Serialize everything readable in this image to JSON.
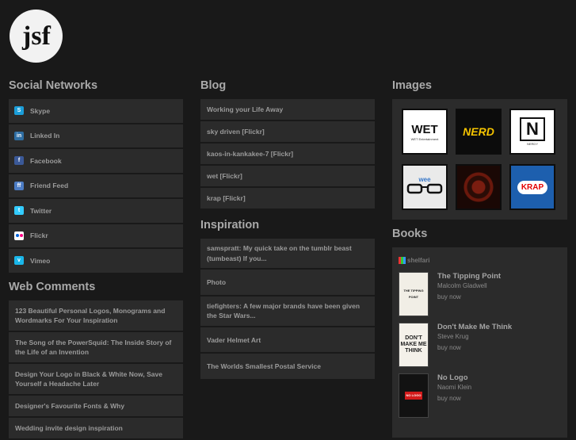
{
  "logo": {
    "text": "jsf"
  },
  "social": {
    "title": "Social Networks",
    "items": [
      {
        "label": "Skype",
        "icon": "skype-icon",
        "color": "#1b9ed9"
      },
      {
        "label": "Linked In",
        "icon": "linkedin-icon",
        "color": "#2f6ea3"
      },
      {
        "label": "Facebook",
        "icon": "facebook-icon",
        "color": "#3b5998"
      },
      {
        "label": "Friend Feed",
        "icon": "friendfeed-icon",
        "color": "#4c7cc4"
      },
      {
        "label": "Twitter",
        "icon": "twitter-icon",
        "color": "#33ccff"
      },
      {
        "label": "Flickr",
        "icon": "flickr-icon",
        "color": "#ffffff"
      },
      {
        "label": "Vimeo",
        "icon": "vimeo-icon",
        "color": "#1ab7ea"
      }
    ]
  },
  "comments": {
    "title": "Web Comments",
    "items": [
      "123 Beautiful Personal Logos, Monograms and Wordmarks For Your Inspiration",
      "The Song of the PowerSquid: The Inside Story of the Life of an Invention",
      "Design Your Logo in Black & White Now, Save Yourself a Headache Later",
      "Designer's Favourite Fonts & Why",
      "Wedding invite design inspiration"
    ]
  },
  "blog": {
    "title": "Blog",
    "items": [
      "Working your Life Away",
      "sky driven [Flickr]",
      "kaos-in-kankakee-7 [Flickr]",
      "wet [Flickr]",
      "krap [Flickr]"
    ]
  },
  "inspiration": {
    "title": "Inspiration",
    "items": [
      "samspratt: My quick take on the tumblr beast (tumbeast) If you...",
      "Photo",
      "tiefighters: A few major brands have been given the Star Wars...",
      "Vader Helmet Art",
      "The Worlds Smallest Postal Service"
    ]
  },
  "images": {
    "title": "Images",
    "thumbs": [
      {
        "name": "wet-thumbnail",
        "text": "WET",
        "sub": "WET Entertainment"
      },
      {
        "name": "nerd-thumbnail",
        "text": "NERD"
      },
      {
        "name": "nerdy-rating-thumbnail",
        "text": "N",
        "sub": "NERDY"
      },
      {
        "name": "glasses-thumbnail",
        "text": "wee"
      },
      {
        "name": "red-pattern-thumbnail",
        "text": ""
      },
      {
        "name": "krap-thumbnail",
        "text": "KRAP"
      }
    ]
  },
  "books": {
    "title": "Books",
    "badge": "shelfari",
    "items": [
      {
        "title": "The Tipping Point",
        "author": "Malcolm Gladwell",
        "buy": "buy now",
        "cover_text": "THE TIPPING POINT",
        "cover_color": "#f1eee6"
      },
      {
        "title": "Don't Make Me Think",
        "author": "Steve Krug",
        "buy": "buy now",
        "cover_text": "DON'T MAKE ME THINK",
        "cover_color": "#f4f1ea"
      },
      {
        "title": "No Logo",
        "author": "Naomi Klein",
        "buy": "buy now",
        "cover_text": "NO LOGO",
        "cover_color": "#121212"
      }
    ]
  }
}
